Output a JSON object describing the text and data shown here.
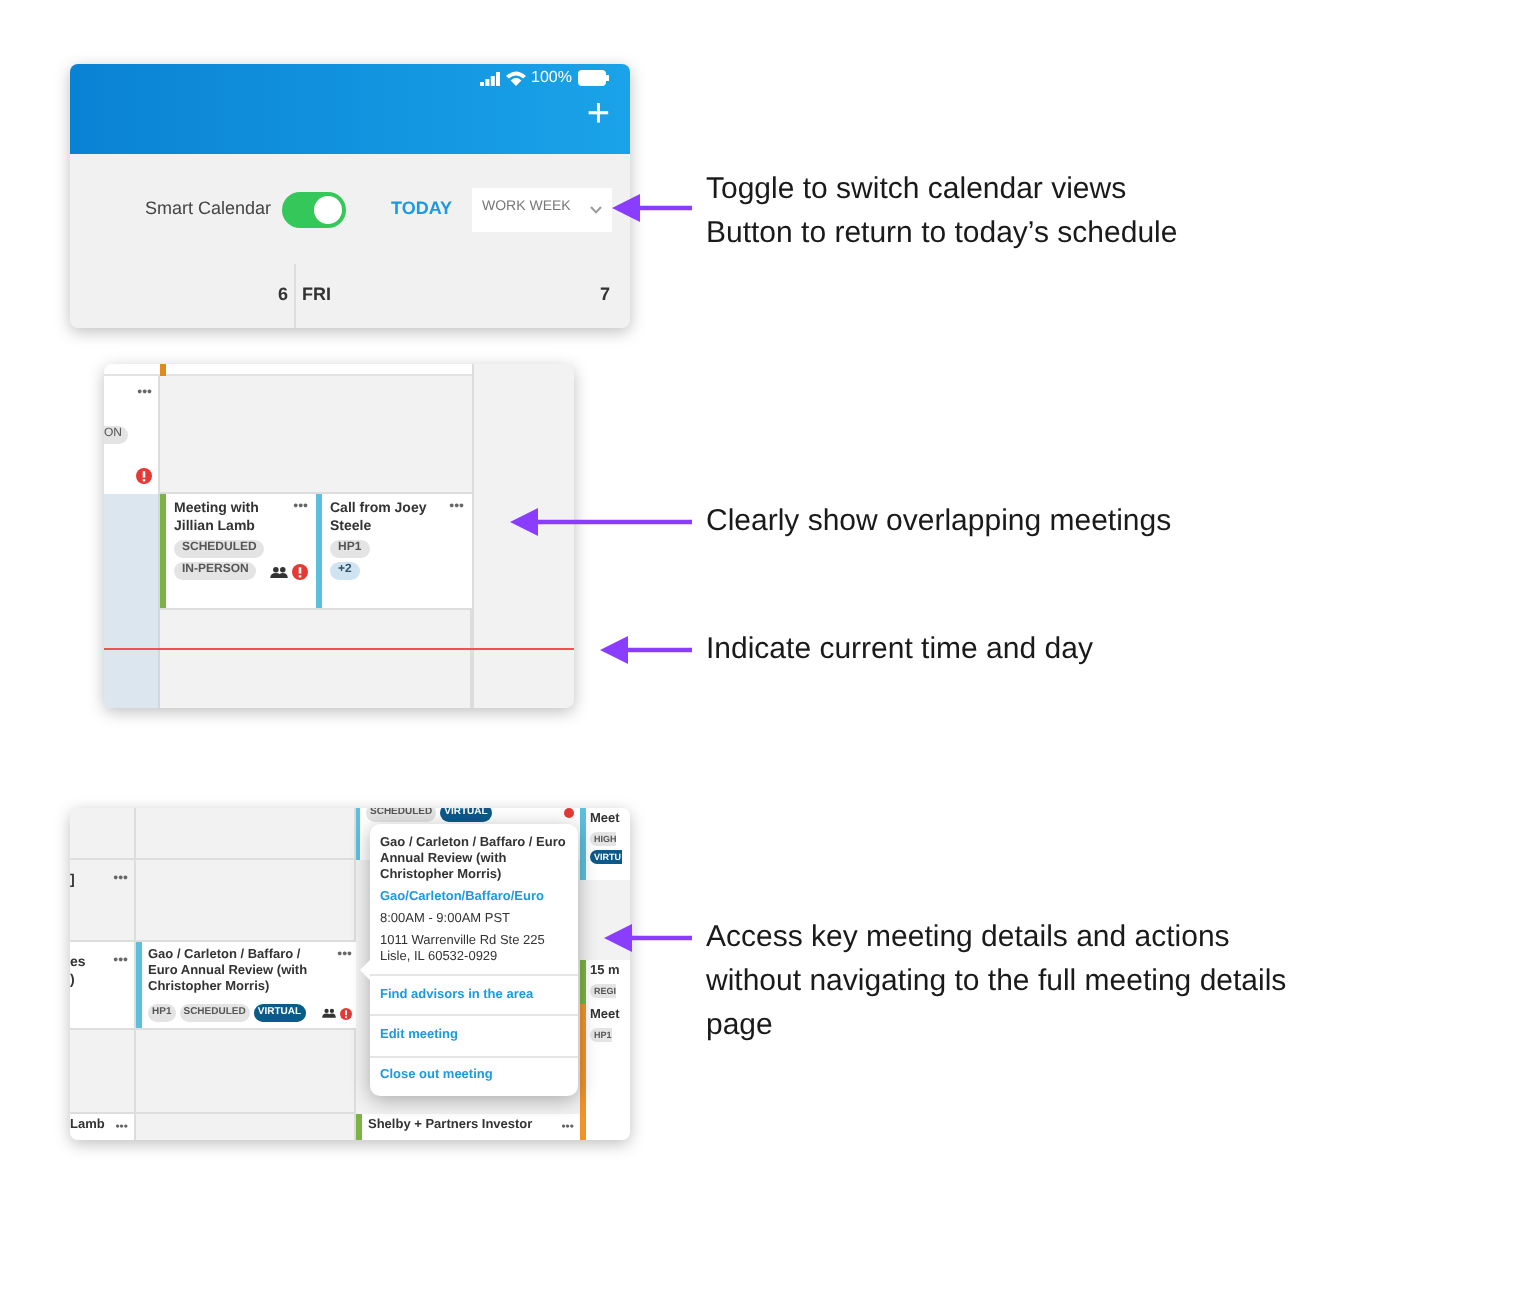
{
  "schedule_header": {
    "battery": "100%",
    "add": "+",
    "smart_calendar": {
      "label": "Smart Calendar",
      "on": true
    },
    "today": "TODAY",
    "view": "WORK WEEK",
    "days": [
      "6",
      "FRI",
      "7"
    ]
  },
  "notes_header": [
    "Toggle to switch calendar views",
    "Button to return to today’s schedule"
  ],
  "overlap_view": {
    "top_card": {
      "menu": "•••",
      "tag": "ON",
      "alert": true
    },
    "meetings": [
      {
        "title": "Meeting with Jillian Lamb",
        "menu": "•••",
        "color": "#7cb342",
        "tags": [
          {
            "label": "SCHEDULED",
            "kind": "gray"
          },
          {
            "label": "IN-PERSON",
            "kind": "gray"
          }
        ],
        "attendees": true,
        "alert": true
      },
      {
        "title": "Call from Joey Steele",
        "menu": "•••",
        "color": "#5bc0de",
        "tags": [
          {
            "label": "HP1",
            "kind": "gray"
          },
          {
            "label": "+2",
            "kind": "blue"
          }
        ],
        "attendees": false,
        "alert": false
      }
    ]
  },
  "notes_overlap": [
    "Clearly show overlapping meetings",
    "Indicate current time and day"
  ],
  "details_view": {
    "top_tags": [
      {
        "label": "SCHEDULED",
        "kind": "gray"
      },
      {
        "label": "VIRTUAL",
        "kind": "dark"
      }
    ],
    "left_rows": [
      {
        "lines": [
          "]"
        ],
        "menu": "•••"
      },
      {
        "lines": [
          "es",
          ")"
        ],
        "menu": "•••"
      }
    ],
    "card": {
      "title": "Gao / Carleton / Baffaro / Euro Annual Review (with Christopher Morris)",
      "menu": "•••",
      "color": "#5bc0de",
      "tags": [
        {
          "label": "HP1",
          "kind": "gray"
        },
        {
          "label": "SCHEDULED",
          "kind": "gray"
        },
        {
          "label": "VIRTUAL",
          "kind": "dark"
        }
      ],
      "attendees": true,
      "alert": true
    },
    "popup": {
      "title": "Gao / Carleton / Baffaro / Euro Annual Review (with Christopher Morris)",
      "link": "Gao/Carleton/Baffaro/Euro",
      "time": "8:00AM - 9:00AM PST",
      "address": [
        "1011 Warrenville Rd Ste 225",
        "Lisle, IL 60532-0929"
      ],
      "actions": [
        "Find advisors in the area",
        "Edit meeting",
        "Close out meeting"
      ]
    },
    "right_cards": [
      {
        "title": "Meet",
        "color": "#5bc0de",
        "tags": [
          {
            "label": "HIGH",
            "kind": "gray"
          },
          {
            "label": "VIRTU",
            "kind": "dark"
          }
        ]
      },
      {
        "title": "15 m",
        "color": "#7cb342",
        "tags": [
          {
            "label": "REGI",
            "kind": "gray"
          }
        ]
      },
      {
        "title": "Meet",
        "color": "#f0932b",
        "tags": [
          {
            "label": "HP1",
            "kind": "gray"
          }
        ]
      }
    ],
    "bottom_left": {
      "text": "Lamb",
      "menu": "•••"
    },
    "bottom_card": {
      "title": "Shelby + Partners Investor",
      "menu": "•••",
      "color": "#7cb342"
    }
  },
  "notes_details": [
    "Access key meeting details and actions without navigating to the full meeting details page"
  ]
}
